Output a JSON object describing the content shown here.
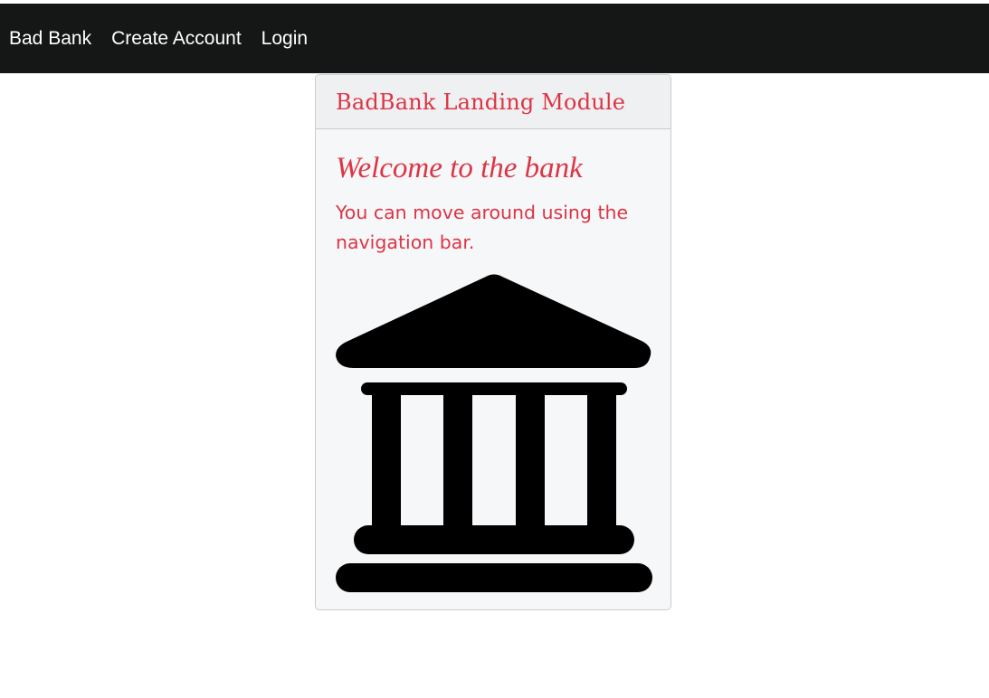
{
  "navbar": {
    "brand": "Bad Bank",
    "links": [
      "Create Account",
      "Login"
    ]
  },
  "card": {
    "header": "BadBank Landing Module",
    "title": "Welcome to the bank",
    "text": "You can move around using the navigation bar.",
    "image_icon": "bank-icon"
  },
  "colors": {
    "navbar_bg": "#151716",
    "accent": "#dc3545",
    "card_bg": "#f6f7f9",
    "card_header_bg": "#eff0f2"
  }
}
